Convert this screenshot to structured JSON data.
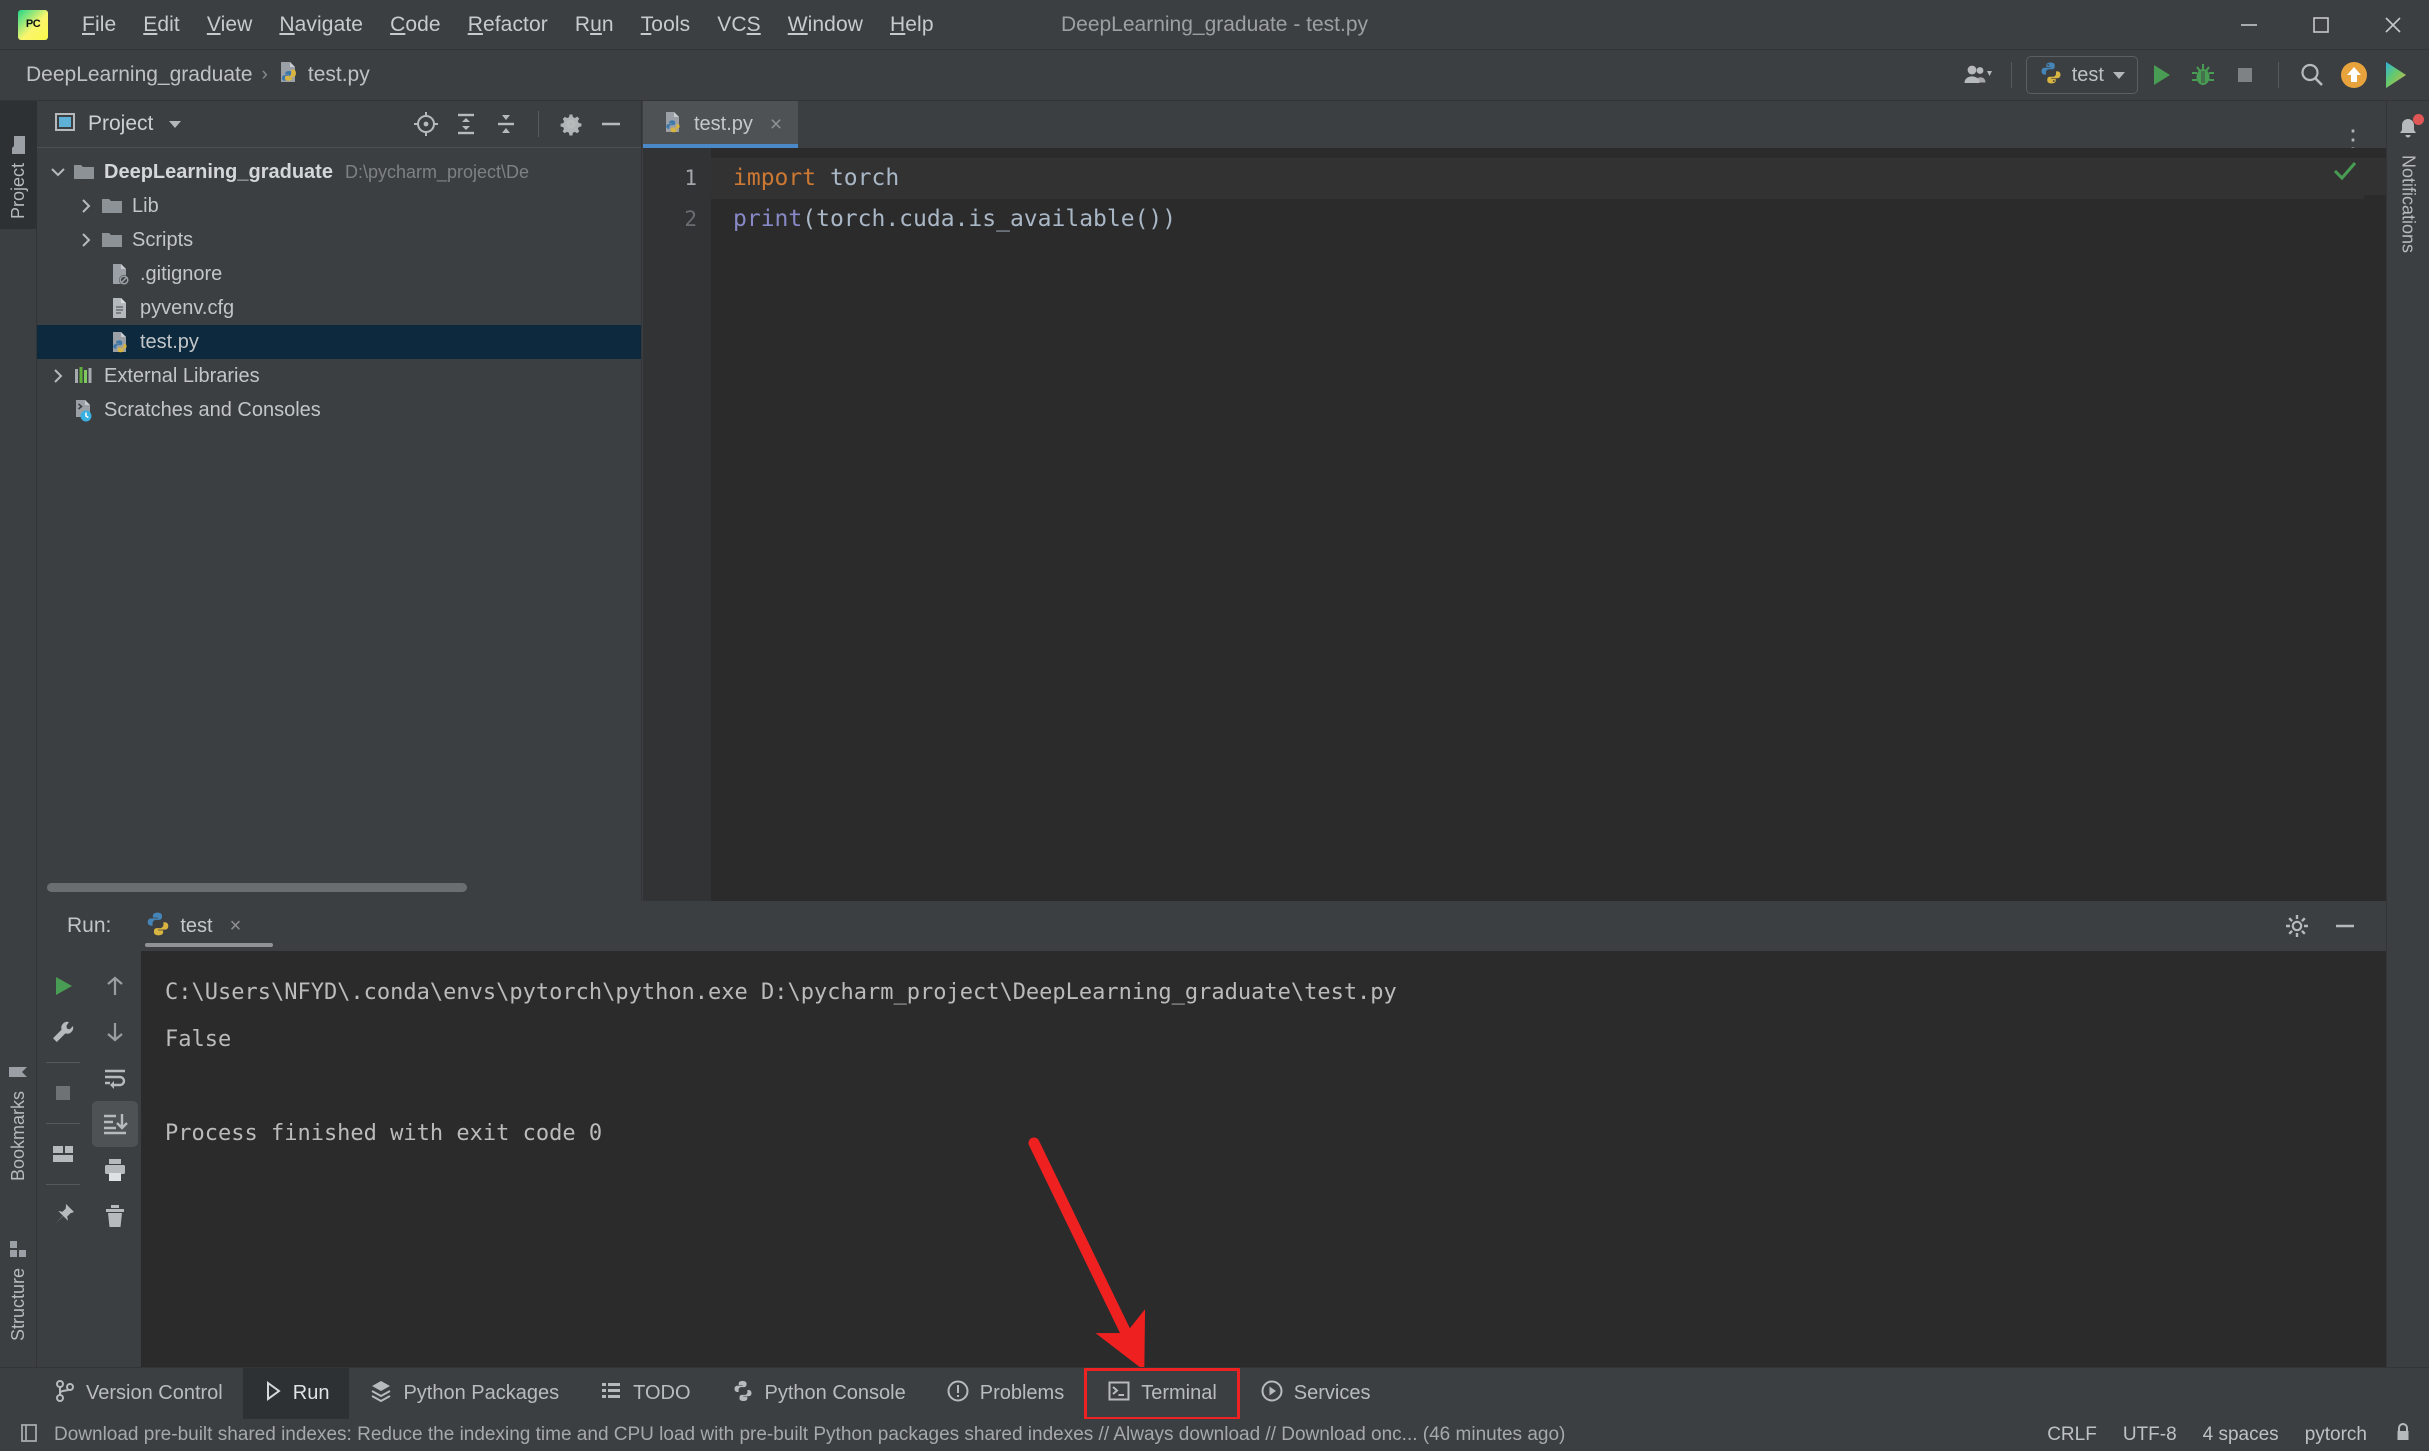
{
  "window": {
    "title": "DeepLearning_graduate - test.py",
    "logo_text": "PC",
    "minimize_label": "Minimize",
    "maximize_label": "Maximize",
    "close_label": "Close"
  },
  "menubar": {
    "items": [
      {
        "label": "File",
        "mnemonic": "F"
      },
      {
        "label": "Edit",
        "mnemonic": "E"
      },
      {
        "label": "View",
        "mnemonic": "V"
      },
      {
        "label": "Navigate",
        "mnemonic": "N"
      },
      {
        "label": "Code",
        "mnemonic": "C"
      },
      {
        "label": "Refactor",
        "mnemonic": "R"
      },
      {
        "label": "Run",
        "mnemonic": "u"
      },
      {
        "label": "Tools",
        "mnemonic": "T"
      },
      {
        "label": "VCS",
        "mnemonic": "S"
      },
      {
        "label": "Window",
        "mnemonic": "W"
      },
      {
        "label": "Help",
        "mnemonic": "H"
      }
    ]
  },
  "navbar": {
    "breadcrumb": [
      "DeepLearning_graduate",
      "test.py"
    ],
    "separator": "›",
    "run_config": "test",
    "icons": {
      "accounts": "accounts-icon",
      "run": "run-icon",
      "debug": "debug-icon",
      "stop": "stop-icon",
      "search": "search-icon",
      "updates": "update-icon",
      "ide_feature": "ide-feature-icon"
    }
  },
  "left_stripe": {
    "tabs": [
      {
        "label": "Project",
        "active": true,
        "icon": "folder-icon"
      },
      {
        "label": "Bookmarks",
        "active": false,
        "icon": "bookmark-icon"
      },
      {
        "label": "Structure",
        "active": false,
        "icon": "structure-icon"
      }
    ]
  },
  "right_stripe": {
    "tabs": [
      {
        "label": "Notifications",
        "icon": "bell-icon",
        "badge": true
      }
    ]
  },
  "project_panel": {
    "title": "Project",
    "toolbar": [
      "locate-icon",
      "expand-all-icon",
      "collapse-all-icon",
      "settings-icon",
      "hide-icon"
    ],
    "tree": [
      {
        "name": "DeepLearning_graduate",
        "sub": "D:\\pycharm_project\\De",
        "icon": "folder-icon",
        "arrow": "down",
        "indent": 0,
        "bold": true,
        "selected": false
      },
      {
        "name": "Lib",
        "sub": "",
        "icon": "folder-icon",
        "arrow": "right",
        "indent": 1,
        "bold": false,
        "selected": false
      },
      {
        "name": "Scripts",
        "sub": "",
        "icon": "folder-icon",
        "arrow": "right",
        "indent": 1,
        "bold": false,
        "selected": false
      },
      {
        "name": ".gitignore",
        "sub": "",
        "icon": "gitignore-file-icon",
        "arrow": "none",
        "indent": 2,
        "bold": false,
        "selected": false
      },
      {
        "name": "pyvenv.cfg",
        "sub": "",
        "icon": "config-file-icon",
        "arrow": "none",
        "indent": 2,
        "bold": false,
        "selected": false
      },
      {
        "name": "test.py",
        "sub": "",
        "icon": "python-file-icon",
        "arrow": "none",
        "indent": 2,
        "bold": false,
        "selected": true
      },
      {
        "name": "External Libraries",
        "sub": "",
        "icon": "libraries-icon",
        "arrow": "right",
        "indent": 0,
        "bold": false,
        "selected": false
      },
      {
        "name": "Scratches and Consoles",
        "sub": "",
        "icon": "scratches-icon",
        "arrow": "none",
        "indent": 0,
        "bold": false,
        "selected": false
      }
    ]
  },
  "editor": {
    "tabs": [
      {
        "label": "test.py",
        "icon": "python-file-icon",
        "active": true,
        "close": "×"
      }
    ],
    "options_icon": "editor-options-icon",
    "inspection_status": "inspections-ok-check-icon",
    "lines": [
      {
        "num": "1",
        "current": true,
        "tokens": [
          {
            "text": "import",
            "cls": "kw"
          },
          {
            "text": " torch",
            "cls": "plain"
          }
        ]
      },
      {
        "num": "2",
        "current": false,
        "tokens": [
          {
            "text": "print",
            "cls": "fn"
          },
          {
            "text": "(torch.cuda.is_available())",
            "cls": "plain"
          }
        ]
      }
    ],
    "line1_plain": "import torch",
    "line2_plain": "print(torch.cuda.is_available())"
  },
  "run_panel": {
    "label": "Run:",
    "tab": "test",
    "tab_close": "×",
    "tab_icon": "python-icon",
    "header_tools": [
      "settings-icon",
      "hide-icon"
    ],
    "left_toolbar": [
      "rerun-icon",
      "wrench-icon",
      "stop-icon",
      "layout-icon",
      "pin-icon"
    ],
    "right_toolbar": [
      "up-arrow-icon",
      "down-arrow-icon",
      "soft-wrap-icon",
      "scroll-to-end-icon",
      "print-icon",
      "trash-icon"
    ],
    "console_lines": [
      "C:\\Users\\NFYD\\.conda\\envs\\pytorch\\python.exe D:\\pycharm_project\\DeepLearning_graduate\\test.py",
      "False",
      "",
      "Process finished with exit code 0"
    ]
  },
  "annotation": {
    "color": "#ee2020",
    "type": "arrow",
    "points_to": "Terminal"
  },
  "tool_window_bar": {
    "items": [
      {
        "label": "Version Control",
        "icon": "vcs-icon",
        "active": false,
        "highlighted": false
      },
      {
        "label": "Run",
        "icon": "run-icon",
        "active": true,
        "highlighted": false
      },
      {
        "label": "Python Packages",
        "icon": "packages-icon",
        "active": false,
        "highlighted": false
      },
      {
        "label": "TODO",
        "icon": "todo-icon",
        "active": false,
        "highlighted": false
      },
      {
        "label": "Python Console",
        "icon": "python-console-icon",
        "active": false,
        "highlighted": false
      },
      {
        "label": "Problems",
        "icon": "problems-icon",
        "active": false,
        "highlighted": false
      },
      {
        "label": "Terminal",
        "icon": "terminal-icon",
        "active": false,
        "highlighted": true
      },
      {
        "label": "Services",
        "icon": "services-icon",
        "active": false,
        "highlighted": false
      }
    ]
  },
  "status_bar": {
    "icon": "notification-event-icon",
    "message": "Download pre-built shared indexes: Reduce the indexing time and CPU load with pre-built Python packages shared indexes // Always download // Download onc... (46 minutes ago)",
    "line_separator": "CRLF",
    "encoding": "UTF-8",
    "indent": "4 spaces",
    "interpreter": "pytorch",
    "lock_icon": "lock-icon"
  },
  "colors": {
    "accent_blue": "#4a88c7",
    "selection_blue": "#0d293e",
    "annotation_red": "#ee2020",
    "keyword_orange": "#cc7832",
    "function_violet": "#8888c6",
    "panel_bg": "#3c3f41",
    "editor_bg": "#2b2b2b",
    "run_ok_green": "#499c54"
  }
}
